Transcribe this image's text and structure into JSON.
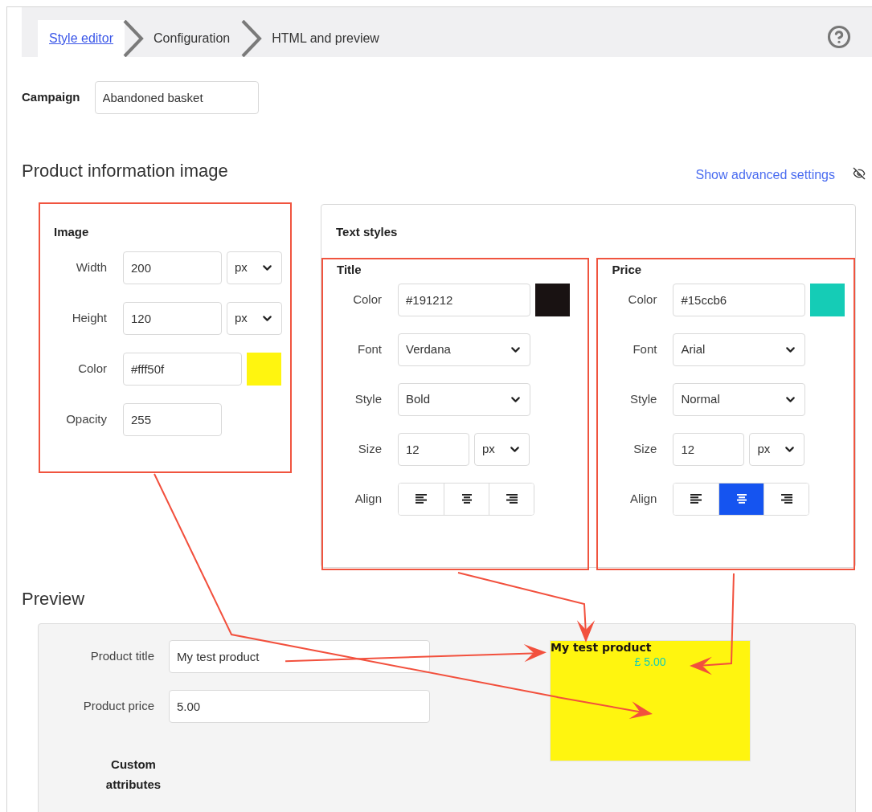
{
  "steps": [
    {
      "label": "Style editor",
      "selected": true
    },
    {
      "label": "Configuration",
      "selected": false
    },
    {
      "label": "HTML and preview",
      "selected": false
    }
  ],
  "campaign": {
    "label": "Campaign",
    "value": "Abandoned basket"
  },
  "section_title": "Product information image",
  "advanced_link": "Show advanced settings",
  "image_panel": {
    "title": "Image",
    "rows": [
      {
        "kind": "unit",
        "label": "Width",
        "value": "200",
        "unit": "px"
      },
      {
        "kind": "unit",
        "label": "Height",
        "value": "120",
        "unit": "px"
      },
      {
        "kind": "color",
        "label": "Color",
        "value": "#fff50f",
        "color": "#fff50f"
      },
      {
        "kind": "plain",
        "label": "Opacity",
        "value": "255"
      }
    ]
  },
  "text_styles": {
    "title": "Text styles",
    "groups": [
      {
        "title": "Title",
        "rows": [
          {
            "kind": "color",
            "label": "Color",
            "value": "#191212",
            "color": "#191212"
          },
          {
            "kind": "select",
            "label": "Font",
            "value": "Verdana"
          },
          {
            "kind": "select",
            "label": "Style",
            "value": "Bold"
          },
          {
            "kind": "unit",
            "label": "Size",
            "value": "12",
            "unit": "px"
          },
          {
            "kind": "align",
            "label": "Align",
            "options": [
              {
                "selected": false
              },
              {
                "selected": false
              },
              {
                "selected": false
              }
            ]
          }
        ]
      },
      {
        "title": "Price",
        "rows": [
          {
            "kind": "color",
            "label": "Color",
            "value": "#15ccb6",
            "color": "#15ccb6"
          },
          {
            "kind": "select",
            "label": "Font",
            "value": "Arial"
          },
          {
            "kind": "select",
            "label": "Style",
            "value": "Normal"
          },
          {
            "kind": "unit",
            "label": "Size",
            "value": "12",
            "unit": "px"
          },
          {
            "kind": "align",
            "label": "Align",
            "options": [
              {
                "selected": false
              },
              {
                "selected": true
              },
              {
                "selected": false
              }
            ]
          }
        ]
      }
    ]
  },
  "preview": {
    "title": "Preview",
    "fields": [
      {
        "label": "Product title",
        "value": "My test product"
      },
      {
        "label": "Product price",
        "value": "5.00"
      }
    ],
    "custom_label": "Custom attributes",
    "sample": {
      "title": "My test product",
      "price": "£ 5.00"
    }
  }
}
